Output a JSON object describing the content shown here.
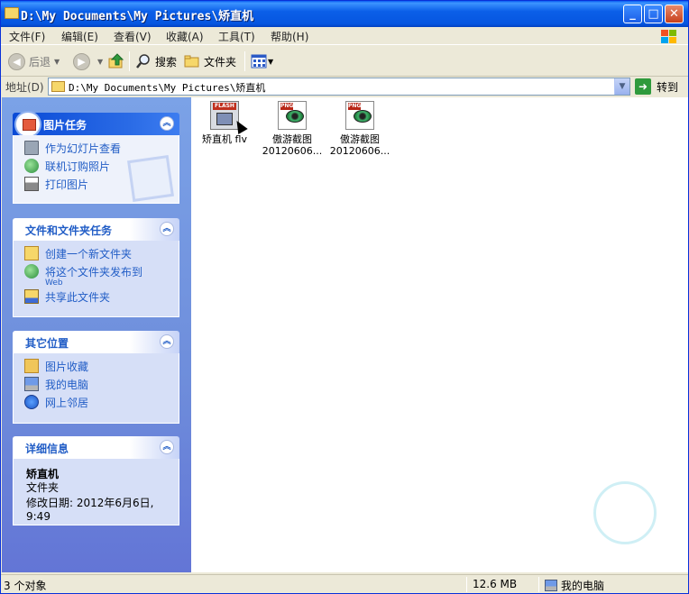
{
  "window": {
    "title": "D:\\My Documents\\My Pictures\\矫直机",
    "buttons": {
      "minimize": "_",
      "maximize": "□",
      "close": "✕"
    }
  },
  "menu": [
    "文件(F)",
    "编辑(E)",
    "查看(V)",
    "收藏(A)",
    "工具(T)",
    "帮助(H)"
  ],
  "toolbar": {
    "back": "后退",
    "search": "搜索",
    "folders": "文件夹"
  },
  "address": {
    "label": "地址(D)",
    "path": "D:\\My Documents\\My Pictures\\矫直机",
    "go": "转到"
  },
  "panels": {
    "picture_tasks": {
      "title": "图片任务",
      "items": [
        "作为幻灯片查看",
        "联机订购照片",
        "打印图片"
      ]
    },
    "file_tasks": {
      "title": "文件和文件夹任务",
      "items": [
        "创建一个新文件夹",
        "将这个文件夹发布到",
        "共享此文件夹"
      ],
      "publish_sub": "Web"
    },
    "other_places": {
      "title": "其它位置",
      "items": [
        "图片收藏",
        "我的电脑",
        "网上邻居"
      ]
    },
    "details": {
      "title": "详细信息",
      "name": "矫直机",
      "type": "文件夹",
      "modified": "修改日期: 2012年6月6日,",
      "time": "9:49"
    }
  },
  "files": [
    {
      "name": "矫直机 flv",
      "kind": "flash",
      "badge": "FLASH"
    },
    {
      "name": "傲游截图",
      "sub": "20120606...",
      "kind": "png",
      "badge": "PNG"
    },
    {
      "name": "傲游截图",
      "sub": "20120606...",
      "kind": "png",
      "badge": "PNG"
    }
  ],
  "status": {
    "count": "3 个对象",
    "size": "12.6 MB",
    "location": "我的电脑"
  }
}
